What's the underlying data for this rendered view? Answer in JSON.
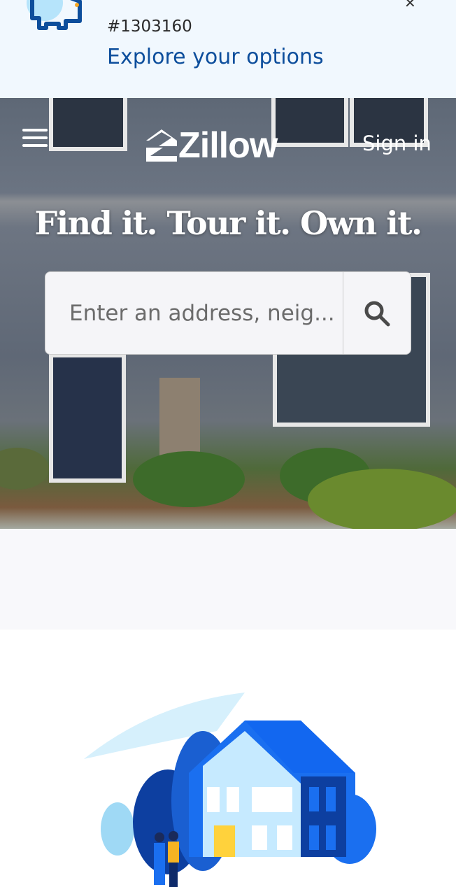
{
  "banner": {
    "code": "#1303160",
    "link": "Explore your options"
  },
  "header": {
    "brand": "Zillow",
    "sign_in": "Sign in"
  },
  "hero": {
    "headline": "Find it. Tour it. Own it.",
    "search_placeholder": "Enter an address, neig..."
  },
  "colors": {
    "banner_bg": "#f1f8fe",
    "link": "#0d4e9c",
    "brand_blue": "#006aff"
  }
}
